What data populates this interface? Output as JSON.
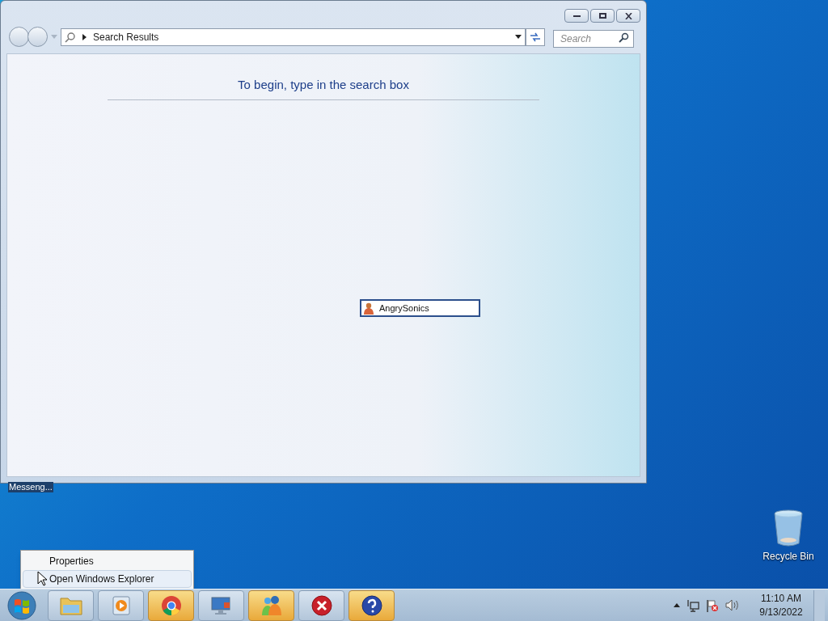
{
  "window": {
    "address": "Search Results",
    "search": {
      "placeholder": "Search"
    },
    "heading": "To begin, type in the search box",
    "floating_item": "AngrySonics"
  },
  "tooltip": "Messeng...",
  "context_menu": [
    {
      "label": "Properties",
      "selected": false
    },
    {
      "label": "Open Windows Explorer",
      "selected": true
    }
  ],
  "desktop_icons": [
    {
      "label": "Recycle Bin"
    }
  ],
  "taskbar": {
    "items": [
      {
        "kind": "folder",
        "highlighted": false
      },
      {
        "kind": "media",
        "highlighted": false
      },
      {
        "kind": "browser",
        "highlighted": true
      },
      {
        "kind": "monitor",
        "highlighted": false
      },
      {
        "kind": "people",
        "highlighted": true
      },
      {
        "kind": "error",
        "highlighted": false
      },
      {
        "kind": "help",
        "highlighted": true
      }
    ],
    "clock": {
      "time": "11:10 AM",
      "date": "9/13/2022"
    }
  }
}
